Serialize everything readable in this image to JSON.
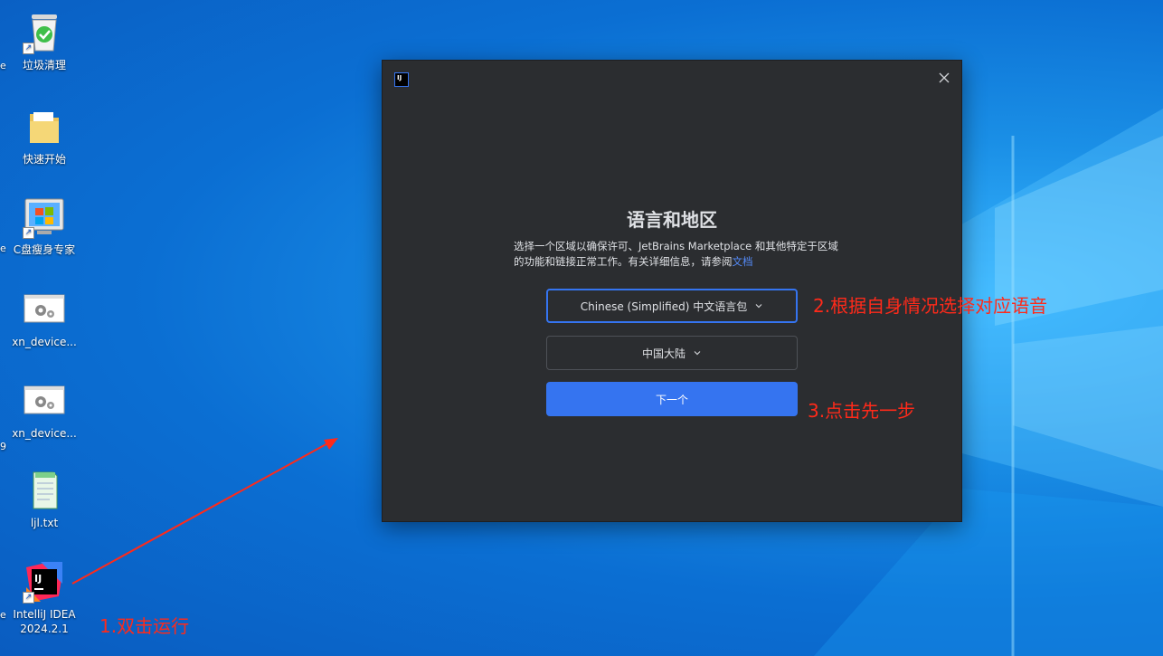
{
  "desktop": {
    "icons": [
      {
        "label": "垃圾清理"
      },
      {
        "label": "快速开始"
      },
      {
        "label": "C盘瘦身专家"
      },
      {
        "label": "xn_device..."
      },
      {
        "label": "xn_device..."
      },
      {
        "label": "ljl.txt"
      },
      {
        "label": "IntelliJ IDEA 2024.2.1"
      }
    ],
    "edge_fragments": [
      "e",
      "e",
      "9",
      "e"
    ]
  },
  "dialog": {
    "logo_text": "IJ",
    "title": "语言和地区",
    "description": "选择一个区域以确保许可、JetBrains Marketplace 和其他特定于区域的功能和链接正常工作。有关详细信息，请参阅",
    "doc_link": "文档",
    "language_select": "Chinese (Simplified) 中文语言包",
    "region_select": "中国大陆",
    "next_button": "下一个"
  },
  "annotations": {
    "step1": "1.双击运行",
    "step2": "2.根据自身情况选择对应语音",
    "step3": "3.点击先一步"
  },
  "colors": {
    "accent": "#3574f0",
    "annotation": "#ff2a1a",
    "dialog_bg": "#2b2d30"
  }
}
